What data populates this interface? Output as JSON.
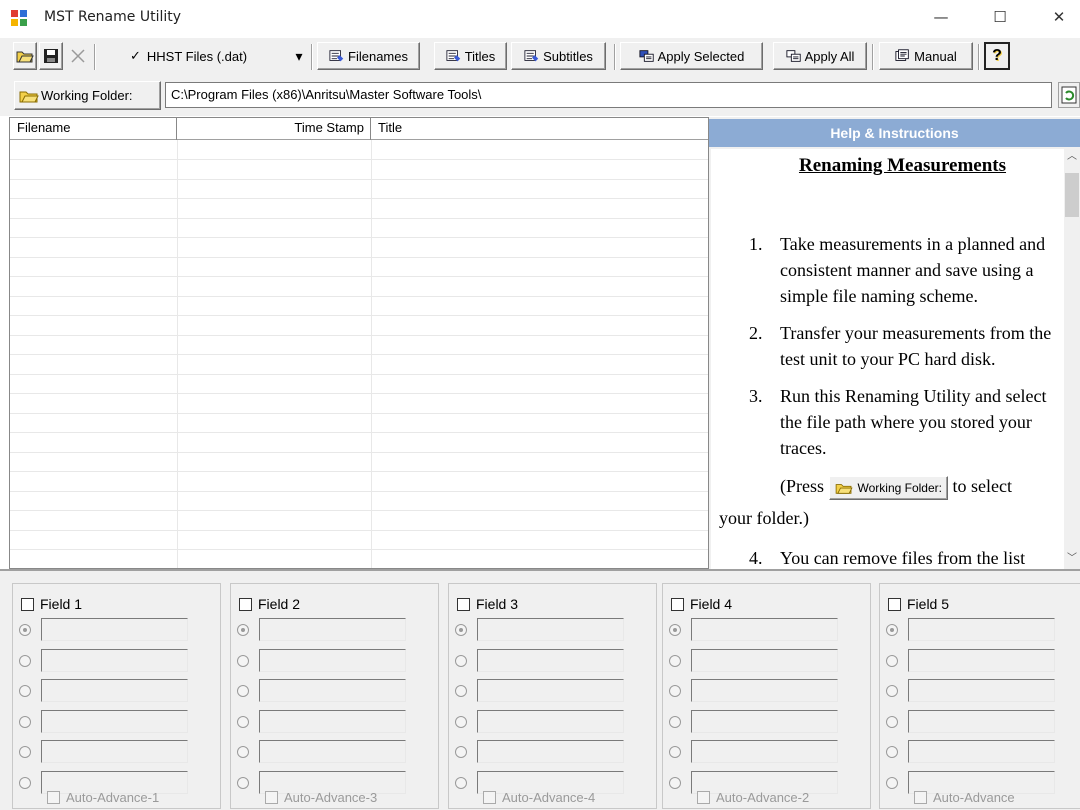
{
  "window": {
    "title": "MST Rename Utility",
    "minimize": "—",
    "maximize": "☐",
    "close": "✕"
  },
  "toolbar": {
    "filter_label": "HHST Files (.dat)",
    "filter_check": "✓",
    "dropdown_arrow": "▾",
    "filenames_label": "Filenames",
    "titles_label": "Titles",
    "subtitles_label": "Subtitles",
    "apply_selected_label": "Apply Selected",
    "apply_all_label": "Apply All",
    "manual_label": "Manual",
    "help_glyph": "?"
  },
  "folder": {
    "button_label": "Working Folder:",
    "path": "C:\\Program Files (x86)\\Anritsu\\Master Software Tools\\"
  },
  "file_list": {
    "columns": [
      "Filename",
      "Time Stamp",
      "Title"
    ]
  },
  "help": {
    "header": "Help & Instructions",
    "title": "Renaming Measurements",
    "steps": [
      {
        "num": "1.",
        "text": "Take measurements in a planned and consistent manner and save using a simple file naming scheme."
      },
      {
        "num": "2.",
        "text": "Transfer your measurements from the test unit to your PC hard disk."
      },
      {
        "num": "3.",
        "text": "Run this Renaming Utility and select the file path where you stored your traces."
      },
      {
        "num": "4.",
        "text": "You can remove files from the list"
      }
    ],
    "press_prefix": "(Press",
    "press_button": "Working Folder:",
    "press_suffix": "to select",
    "press_line2": "your folder.)"
  },
  "fields": [
    {
      "label": "Field 1",
      "auto": "Auto-Advance-1"
    },
    {
      "label": "Field 2",
      "auto": "Auto-Advance-3"
    },
    {
      "label": "Field 3",
      "auto": "Auto-Advance-4"
    },
    {
      "label": "Field 4",
      "auto": "Auto-Advance-2"
    },
    {
      "label": "Field 5",
      "auto": "Auto-Advance"
    }
  ],
  "colors": {
    "help_header": "#8cabd4",
    "window_bg": "#f0f0f0",
    "folder_yellow": "#f3d04a"
  },
  "icons": [
    "open-folder-icon",
    "save-disk-icon",
    "delete-x-icon",
    "filenames-icon",
    "titles-icon",
    "subtitles-icon",
    "apply-selected-icon",
    "apply-all-icon",
    "manual-icon",
    "help-icon",
    "folder-icon",
    "refresh-icon"
  ]
}
